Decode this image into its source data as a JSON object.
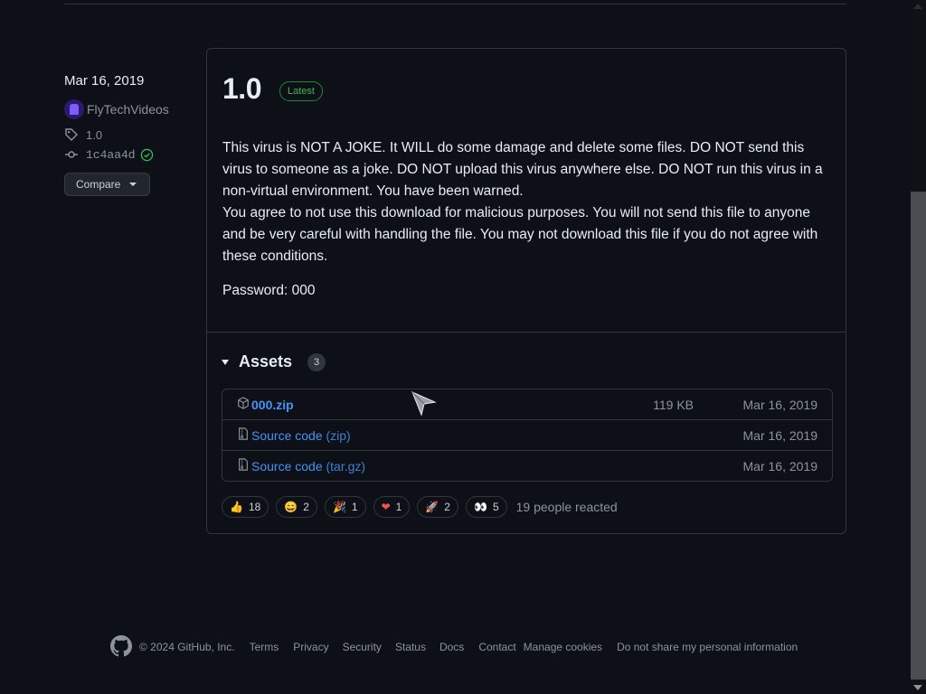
{
  "release": {
    "date": "Mar 16, 2019",
    "author": "FlyTechVideos",
    "tag": "1.0",
    "commit": "1c4aa4d",
    "compare_label": "Compare",
    "title": "1.0",
    "badge": "Latest",
    "body": [
      "This virus is NOT A JOKE. It WILL do some damage and delete some files. DO NOT send this virus to someone as a joke. DO NOT upload this virus anywhere else. DO NOT run this virus in a non-virtual environment. You have been warned.",
      "You agree to not use this download for malicious purposes. You will not send this file to anyone and be very careful with handling the file. You may not download this file if you do not agree with these conditions."
    ],
    "password_line": "Password: 000"
  },
  "assets": {
    "title": "Assets",
    "count": "3",
    "items": [
      {
        "name": "000.zip",
        "suffix": "",
        "size": "119 KB",
        "date": "Mar 16, 2019",
        "icon": "package-icon"
      },
      {
        "name": "Source code",
        "suffix": "(zip)",
        "size": "",
        "date": "Mar 16, 2019",
        "icon": "file-zip-icon"
      },
      {
        "name": "Source code",
        "suffix": "(tar.gz)",
        "size": "",
        "date": "Mar 16, 2019",
        "icon": "file-zip-icon"
      }
    ]
  },
  "reactions": {
    "items": [
      {
        "emoji": "👍",
        "name": "thumbs-up",
        "count": "18"
      },
      {
        "emoji": "😄",
        "name": "laugh",
        "count": "2"
      },
      {
        "emoji": "🎉",
        "name": "hooray",
        "count": "1"
      },
      {
        "emoji": "❤",
        "name": "heart",
        "count": "1"
      },
      {
        "emoji": "🚀",
        "name": "rocket",
        "count": "2"
      },
      {
        "emoji": "👀",
        "name": "eyes",
        "count": "5"
      }
    ],
    "summary": "19 people reacted"
  },
  "footer": {
    "copyright": "© 2024 GitHub, Inc.",
    "links": [
      "Terms",
      "Privacy",
      "Security",
      "Status",
      "Docs",
      "Contact",
      "Manage cookies",
      "Do not share my personal information"
    ]
  },
  "colors": {
    "background": "#0d1117",
    "link": "#4493f8",
    "latest_green": "#3fb950",
    "border": "#30363d"
  }
}
